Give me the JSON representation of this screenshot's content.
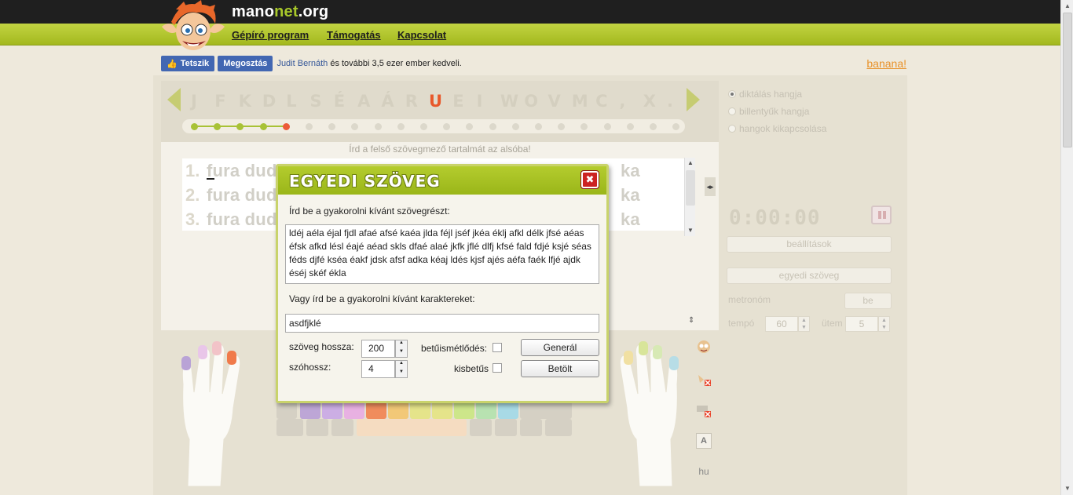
{
  "site": {
    "logo_prefix": "mano",
    "logo_accent": "net",
    "logo_suffix": ".org",
    "nav": [
      "Gépíró program",
      "Támogatás",
      "Kapcsolat"
    ]
  },
  "social": {
    "like_label": "Tetszik",
    "share_label": "Megosztás",
    "friend_name": "Judit Bernáth",
    "like_text": "és további 3,5 ezer ember kedveli.",
    "banana_link": "banana!"
  },
  "lesson": {
    "letters": [
      "J",
      "F",
      "K",
      "D",
      "L",
      "S",
      "É",
      "A",
      "Á",
      "R",
      "U",
      "E",
      "I",
      "W",
      "O",
      "V",
      "M",
      "C",
      ",",
      "X",
      "."
    ],
    "active_letter_index": 10,
    "progress_done": 4,
    "progress_total": 22,
    "instruction": "Írd a felső szövegmező tartalmát az alsóba!",
    "lines": [
      {
        "num": "1.",
        "text_start": "fura dud",
        "text_end": "ka"
      },
      {
        "num": "2.",
        "text_start": "fura dud",
        "text_end": "ka"
      },
      {
        "num": "3.",
        "text_start": "fura dud",
        "text_end": "ka"
      }
    ]
  },
  "settings": {
    "sound_options": [
      "diktálás hangja",
      "billentyűk hangja",
      "hangok kikapcsolása"
    ],
    "sound_selected": 0,
    "timer": "0:00:00",
    "settings_button": "beállítások",
    "custom_text_button": "egyedi szöveg",
    "metronome_label": "metronóm",
    "metronome_toggle": "be",
    "tempo_label": "tempó",
    "tempo_value": "60",
    "beat_label": "ütem",
    "beat_value": "5"
  },
  "toolbar": {
    "lang": "hu",
    "font_letter": "A"
  },
  "modal": {
    "title": "EGYEDI SZÖVEG",
    "close_glyph": "✖",
    "prompt_text": "Írd be a gyakorolni kívánt szövegrészt:",
    "text_value": "ldéj aéla éjal fjdl afaé afsé kaéa jlda féjl jséf jkéa éklj afkl délk jfsé aéas éfsk afkd lésl éajé aéad skls dfaé alaé jkfk jflé dlfj kfsé fald fdjé ksjé séas féds djfé kséa éakf jdsk afsf adka kéaj ldés kjsf ajés aéfa faék lfjé ajdk éséj skéf ékla",
    "prompt_chars": "Vagy írd be a gyakorolni kívánt karaktereket:",
    "chars_value": "asdfjklé",
    "length_label": "szöveg hossza:",
    "length_value": "200",
    "word_length_label": "szóhossz:",
    "word_length_value": "4",
    "repeat_label": "betűismétlődés:",
    "lowercase_label": "kisbetűs",
    "generate_button": "Generál",
    "load_button": "Betölt"
  }
}
